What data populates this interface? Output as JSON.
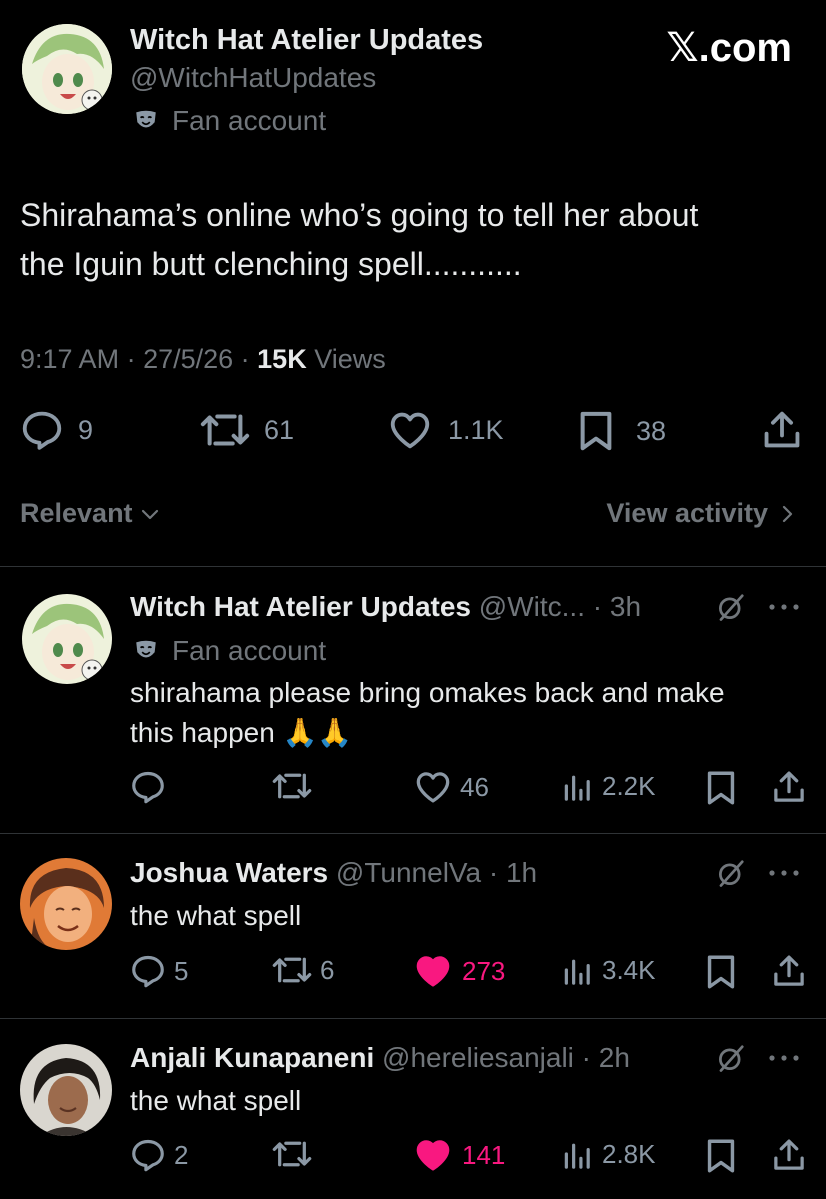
{
  "brand": {
    "label": "𝕏.com"
  },
  "main_tweet": {
    "author_name": "Witch Hat Atelier Updates",
    "handle": "@WitchHatUpdates",
    "label": "Fan account",
    "text_line1": "Shirahama’s online who’s going to tell her about",
    "text_line2": "the Iguin butt clenching spell...........",
    "time": "9:17 AM",
    "date": "27/5/26",
    "views_count": "15K",
    "views_label": "Views",
    "replies": "9",
    "reposts": "61",
    "likes": "1.1K",
    "bookmarks": "38"
  },
  "sort_bar": {
    "sort_label": "Relevant",
    "activity_label": "View activity"
  },
  "replies": [
    {
      "author_name": "Witch Hat Atelier Updates",
      "handle": "@Witc...",
      "age": "3h",
      "label": "Fan account",
      "text_line1": "shirahama please bring omakes back and make",
      "text_line2": "this happen 🙏🙏",
      "replies": "",
      "reposts": "",
      "likes": "46",
      "views": "2.2K",
      "liked": false
    },
    {
      "author_name": "Joshua Waters",
      "handle": "@TunnelVa",
      "age": "1h",
      "text_line1": "the what spell",
      "replies": "5",
      "reposts": "6",
      "likes": "273",
      "views": "3.4K",
      "liked": true
    },
    {
      "author_name": "Anjali Kunapaneni",
      "handle": "@hereliesanjali",
      "age": "2h",
      "text_line1": "the what spell",
      "replies": "2",
      "reposts": "",
      "likes": "141",
      "views": "2.8K",
      "liked": true
    }
  ],
  "colors": {
    "background": "#000000",
    "text": "#e7e9ea",
    "muted": "#71767b",
    "like_active": "#f91880",
    "divider": "#2f3336"
  }
}
